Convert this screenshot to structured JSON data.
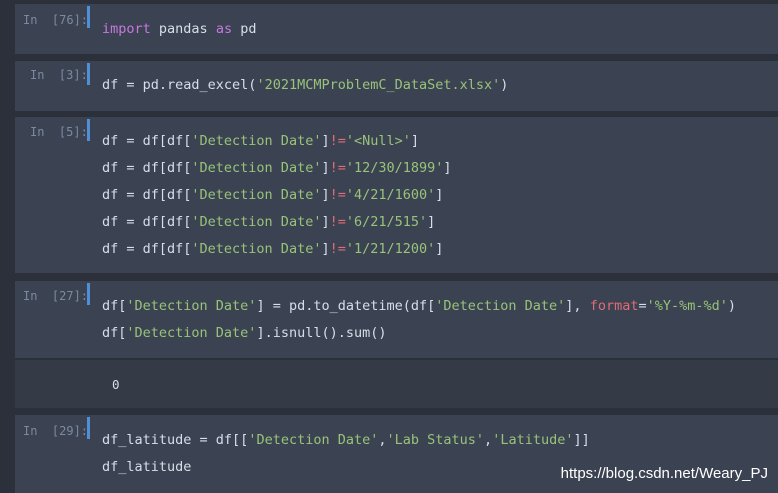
{
  "cells": [
    {
      "prompt": "In  [76]:",
      "lines": [
        "import pandas as pd"
      ]
    },
    {
      "prompt": "In  [3]:",
      "lines": [
        "df = pd.read_excel('2021MCMProblemC_DataSet.xlsx')"
      ]
    },
    {
      "prompt": "In  [5]:",
      "lines": [
        "df = df[df['Detection Date']!='<Null>']",
        "df = df[df['Detection Date']!='12/30/1899']",
        "df = df[df['Detection Date']!='4/21/1600']",
        "df = df[df['Detection Date']!='6/21/515']",
        "df = df[df['Detection Date']!='1/21/1200']"
      ]
    },
    {
      "prompt": "In  [27]:",
      "lines": [
        "df['Detection Date'] = pd.to_datetime(df['Detection Date'], format='%Y-%m-%d')",
        "df['Detection Date'].isnull().sum()"
      ]
    },
    {
      "prompt": "In  [29]:",
      "lines": [
        "df_latitude = df[['Detection Date','Lab Status','Latitude']]",
        "df_latitude"
      ]
    }
  ],
  "output_27": "0",
  "watermark": "https://blog.csdn.net/Weary_PJ",
  "colors": {
    "background": "#2b303b",
    "cell": "#3b4252",
    "accent_bar": "#4f8fd6",
    "string": "#98c379",
    "keyword": "#c678dd"
  }
}
